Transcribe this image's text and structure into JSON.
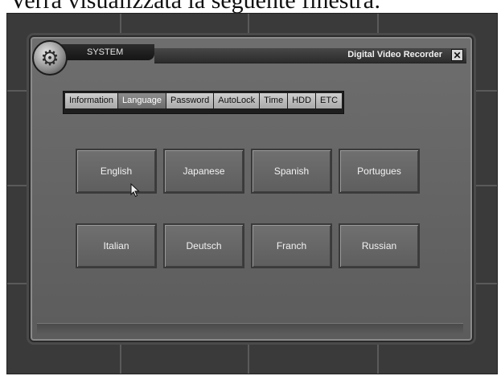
{
  "caption": "Verrà visualizzata la seguente finestra:",
  "window": {
    "system_label": "SYSTEM",
    "app_title": "Digital Video Recorder",
    "close_glyph": "✕",
    "gear_glyph": "⚙"
  },
  "tabs": [
    {
      "label": "Information"
    },
    {
      "label": "Language",
      "active": true
    },
    {
      "label": "Password"
    },
    {
      "label": "AutoLock"
    },
    {
      "label": "Time"
    },
    {
      "label": "HDD"
    },
    {
      "label": "ETC"
    }
  ],
  "languages": [
    "English",
    "Japanese",
    "Spanish",
    "Portugues",
    "Italian",
    "Deutsch",
    "Franch",
    "Russian"
  ],
  "icons": {
    "gear": "gear-icon",
    "close": "close-icon",
    "cursor": "mouse-pointer-icon"
  }
}
